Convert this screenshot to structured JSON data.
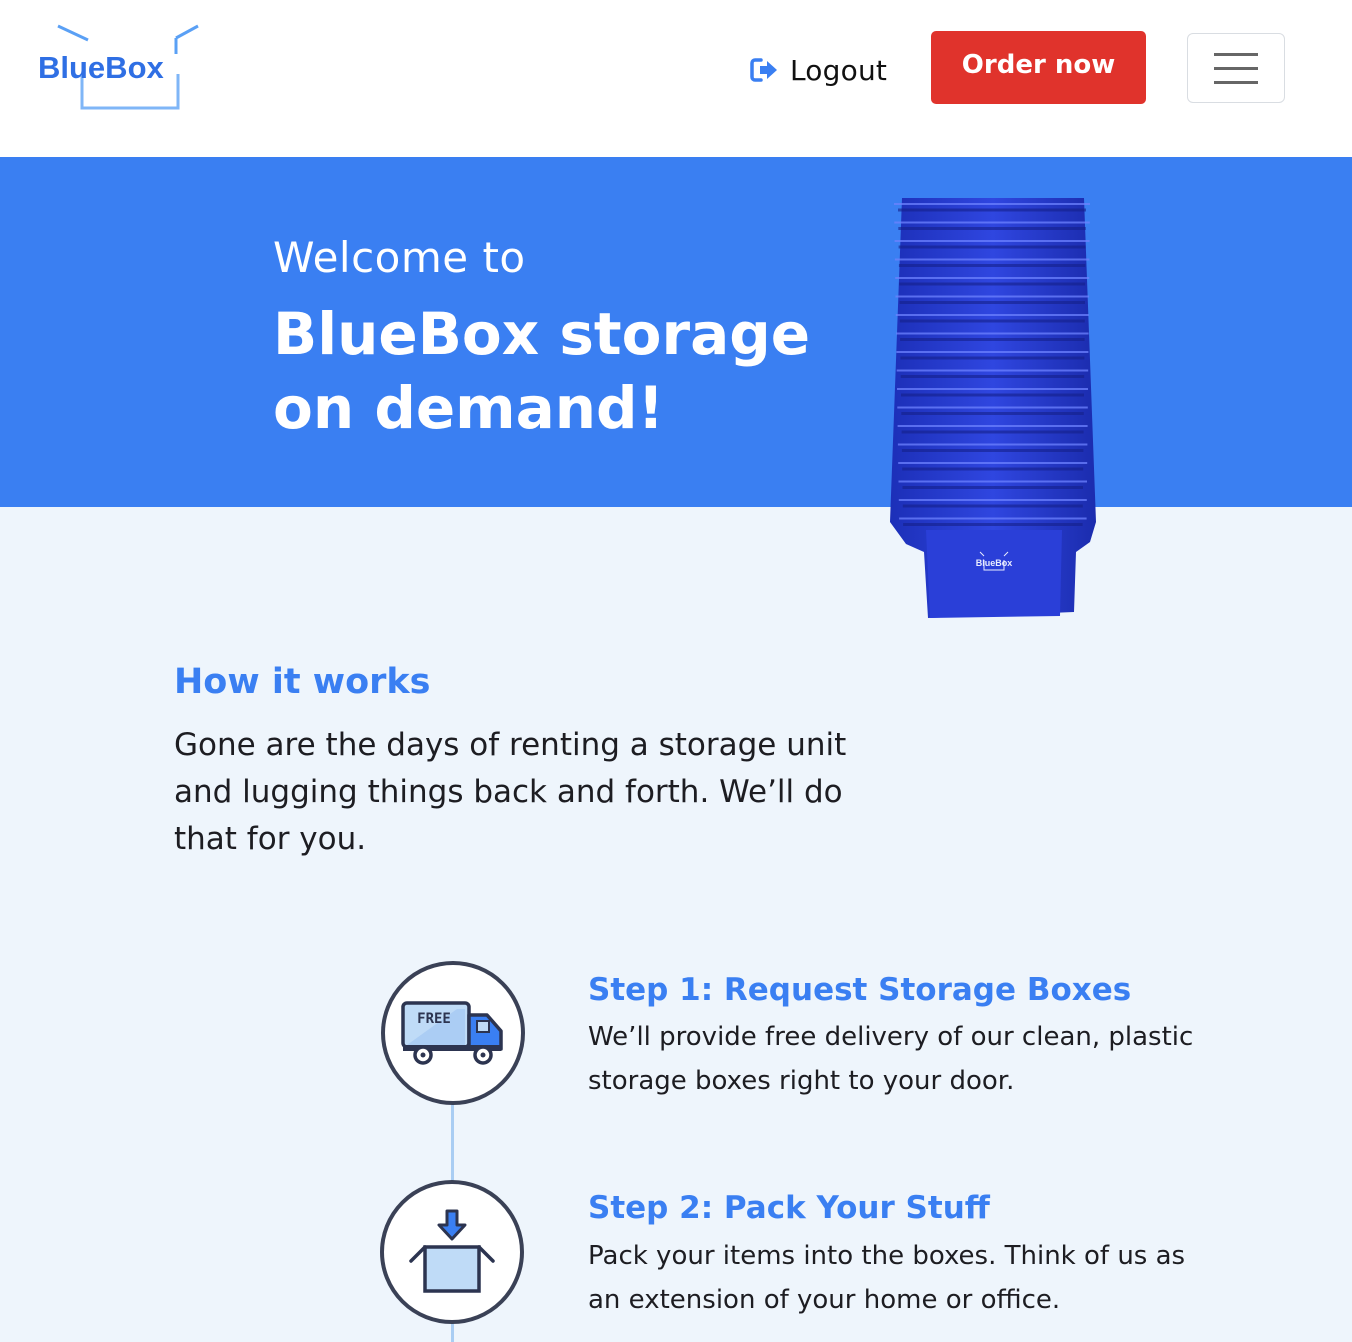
{
  "header": {
    "logo_text": "BlueBox",
    "logout_label": "Logout",
    "order_label": "Order now",
    "menu_icon": "hamburger-icon"
  },
  "hero": {
    "welcome": "Welcome to",
    "headline": "BlueBox storage on demand!",
    "crate_brand": "BlueBox"
  },
  "how": {
    "title": "How it works",
    "text": "Gone are the days of renting a storage unit and lugging things back and forth. We’ll do that for you."
  },
  "steps": [
    {
      "icon": "delivery-truck-icon",
      "badge": "FREE",
      "title": "Step 1: Request Storage Boxes",
      "desc": "We’ll provide free delivery of our clean, plastic storage boxes right to your door."
    },
    {
      "icon": "pack-box-icon",
      "title": "Step 2: Pack Your Stuff",
      "desc": "Pack your items into the boxes. Think of us as an extension of your home or office."
    }
  ],
  "colors": {
    "brand_blue": "#3a7ff2",
    "order_red": "#e0332c",
    "page_bg": "#eef5fc"
  }
}
